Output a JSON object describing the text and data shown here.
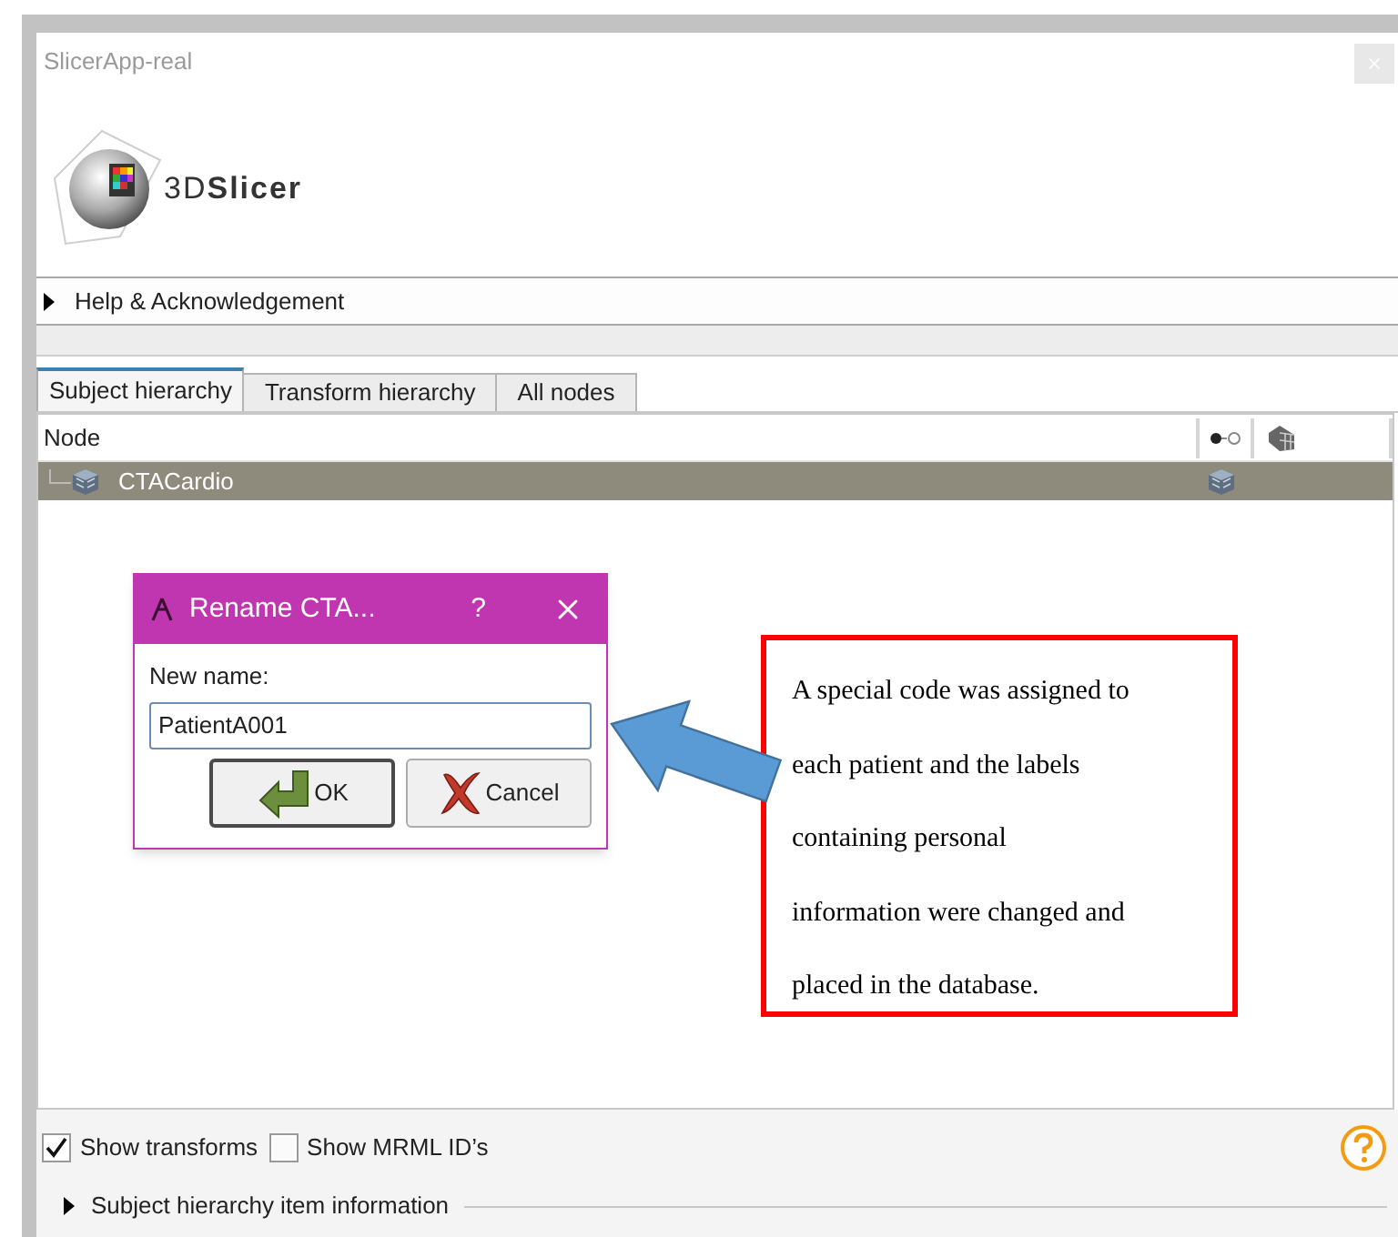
{
  "window": {
    "title": "SlicerApp-real"
  },
  "logo": {
    "text": "3D**Slicer**"
  },
  "help_section": {
    "label": "Help & Acknowledgement",
    "expanded": false
  },
  "tabs": [
    {
      "label": "Subject hierarchy",
      "selected": true
    },
    {
      "label": "Transform hierarchy",
      "selected": false
    },
    {
      "label": "All nodes",
      "selected": false
    }
  ],
  "tree": {
    "columns": [
      "Node"
    ],
    "rows": [
      {
        "name": "CTACardio",
        "selected": true
      }
    ]
  },
  "dialog": {
    "title": "Rename CTA...",
    "help": "?",
    "label": "New name:",
    "value": "PatientA001",
    "buttons": [
      {
        "label": "OK",
        "kind": "ok"
      },
      {
        "label": "Cancel",
        "kind": "cancel"
      }
    ]
  },
  "annotation": {
    "text": "A special code was assigned to\neach patient and the labels\ncontaining personal\ninformation were changed and\nplaced in the database."
  },
  "options": [
    {
      "label": "Show transforms",
      "checked": true
    },
    {
      "label": "Show MRML ID’s",
      "checked": false
    }
  ],
  "item_info": {
    "label": "Subject hierarchy item information",
    "expanded": false
  }
}
